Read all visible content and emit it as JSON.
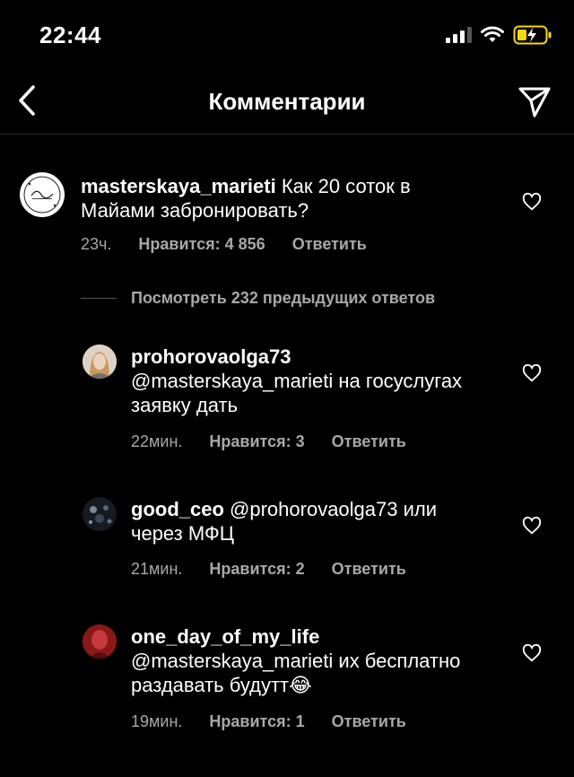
{
  "status": {
    "time": "22:44"
  },
  "header": {
    "title": "Комментарии"
  },
  "comment": {
    "username": "masterskaya_marieti",
    "text": " Как 20 соток в Майами забронировать?",
    "time": "23ч.",
    "likes": "Нравится: 4 856",
    "reply": "Ответить"
  },
  "view_previous": "Посмотреть 232 предыдущих ответов",
  "replies": [
    {
      "username": "prohorovaolga73",
      "mention": "@masterskaya_marieti",
      "text": " на госуслугах заявку дать",
      "time": "22мин.",
      "likes": "Нравится: 3",
      "reply": "Ответить"
    },
    {
      "username": "good_ceo",
      "mention": "@prohorovaolga73",
      "text": " или через МФЦ",
      "time": "21мин.",
      "likes": "Нравится: 2",
      "reply": "Ответить"
    },
    {
      "username": "one_day_of_my_life",
      "mention": "@masterskaya_marieti",
      "text": " их бесплатно раздавать будутт😂",
      "time": "19мин.",
      "likes": "Нравится: 1",
      "reply": "Ответить"
    }
  ],
  "colors": {
    "background": "#000000",
    "text": "#ffffff",
    "secondary": "#a8a8a8",
    "battery": "#f5d90a"
  }
}
